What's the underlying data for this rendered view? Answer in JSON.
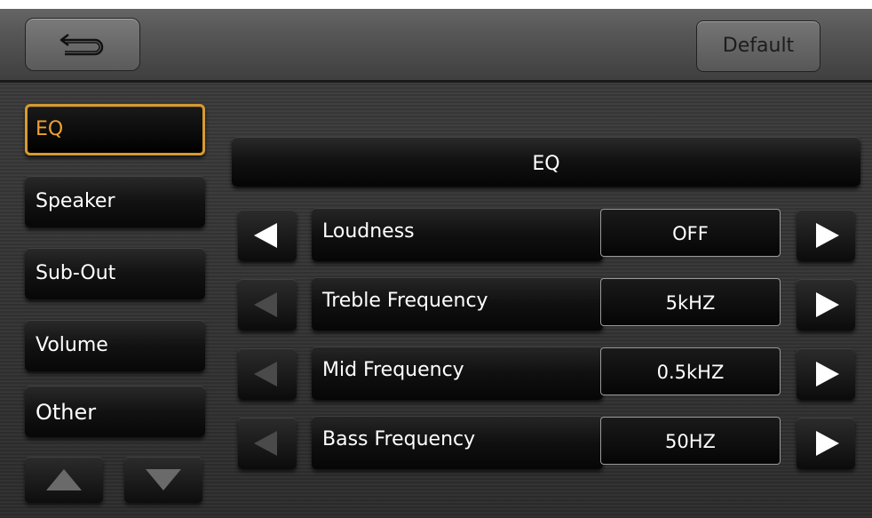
{
  "topbar": {
    "back_icon": "return-arrow-icon",
    "default_label": "Default"
  },
  "menu": {
    "items": [
      {
        "label": "EQ",
        "active": true
      },
      {
        "label": "Speaker",
        "active": false
      },
      {
        "label": "Sub-Out",
        "active": false
      },
      {
        "label": "Volume",
        "active": false
      },
      {
        "label": "Other",
        "active": false
      }
    ],
    "scroll_up_icon": "triangle-up-icon",
    "scroll_down_icon": "triangle-down-icon"
  },
  "section": {
    "title": "EQ"
  },
  "settings": [
    {
      "label": "Loudness",
      "value": "OFF",
      "prev_enabled": true,
      "next_enabled": true
    },
    {
      "label": "Treble Frequency",
      "value": "5kHZ",
      "prev_enabled": false,
      "next_enabled": true
    },
    {
      "label": "Mid Frequency",
      "value": "0.5kHZ",
      "prev_enabled": false,
      "next_enabled": true
    },
    {
      "label": "Bass Frequency",
      "value": "50HZ",
      "prev_enabled": false,
      "next_enabled": true
    }
  ],
  "colors": {
    "active_accent": "#d89a30",
    "text": "#ffffff"
  }
}
